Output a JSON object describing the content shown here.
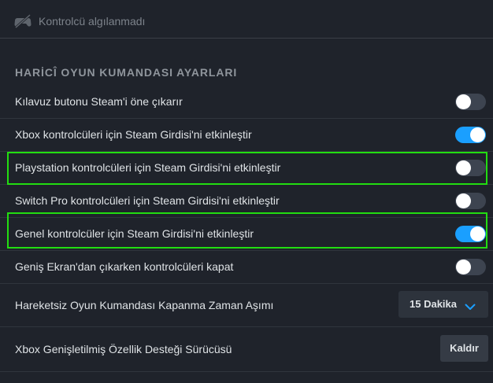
{
  "status": {
    "icon": "controller-off-icon",
    "text": "Kontrolcü algılanmadı"
  },
  "section": {
    "title": "HARİCÎ OYUN KUMANDASI AYARLARI"
  },
  "settings": [
    {
      "label": "Kılavuz butonu Steam'i öne çıkarır",
      "enabled": false
    },
    {
      "label": "Xbox kontrolcüleri için Steam Girdisi'ni etkinleştir",
      "enabled": true
    },
    {
      "label": "Playstation kontrolcüleri için Steam Girdisi'ni etkinleştir",
      "enabled": false
    },
    {
      "label": "Switch Pro kontrolcüleri için Steam Girdisi'ni etkinleştir",
      "enabled": false
    },
    {
      "label": "Genel kontrolcüler için Steam Girdisi'ni etkinleştir",
      "enabled": true
    },
    {
      "label": "Geniş Ekran'dan çıkarken kontrolcüleri kapat",
      "enabled": false
    }
  ],
  "timeout": {
    "label": "Hareketsiz Oyun Kumandası Kapanma Zaman Aşımı",
    "selected": "15 Dakika"
  },
  "xbox_driver": {
    "label": "Xbox Genişletilmiş Özellik Desteği Sürücüsü",
    "button_label": "Kaldır"
  },
  "colors": {
    "background": "#1f232b",
    "toggle_on": "#1a9fff",
    "toggle_off": "#3d4450",
    "highlight": "#22dd11"
  }
}
